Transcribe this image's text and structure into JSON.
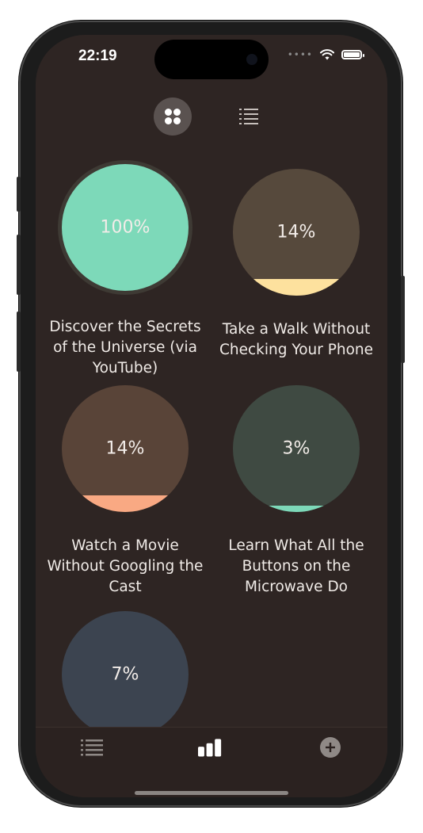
{
  "status_bar": {
    "time": "22:19",
    "signal_icon": "signal-dots-icon",
    "wifi_icon": "wifi-icon",
    "battery_icon": "battery-icon"
  },
  "view_toggle": {
    "grid_icon": "grid-view-icon",
    "list_icon": "list-view-icon",
    "selected": "grid"
  },
  "goals": [
    {
      "title": "Discover the Secrets of the Universe (via YouTube)",
      "percent_label": "100%",
      "progress": 1.0,
      "bg_color": "#3e3a34",
      "fill_color": "#7dd9b9"
    },
    {
      "title": "Take a Walk Without Checking Your Phone",
      "percent_label": "14%",
      "progress": 0.14,
      "bg_color": "#56493c",
      "fill_color": "#fde19e"
    },
    {
      "title": "Watch a Movie Without Googling the Cast",
      "percent_label": "14%",
      "progress": 0.14,
      "bg_color": "#594438",
      "fill_color": "#f9a983"
    },
    {
      "title": "Learn What All the Buttons on the Microwave Do",
      "percent_label": "3%",
      "progress": 0.03,
      "bg_color": "#3f4a42",
      "fill_color": "#7dd9b9"
    },
    {
      "title": "",
      "percent_label": "7%",
      "progress": 0.07,
      "bg_color": "#3c4450",
      "fill_color": "#7eb3ec"
    }
  ],
  "tab_bar": {
    "tabs": [
      {
        "icon": "list-icon",
        "active": false
      },
      {
        "icon": "bar-chart-icon",
        "active": true
      },
      {
        "icon": "plus-circle-icon",
        "active": false
      }
    ]
  }
}
